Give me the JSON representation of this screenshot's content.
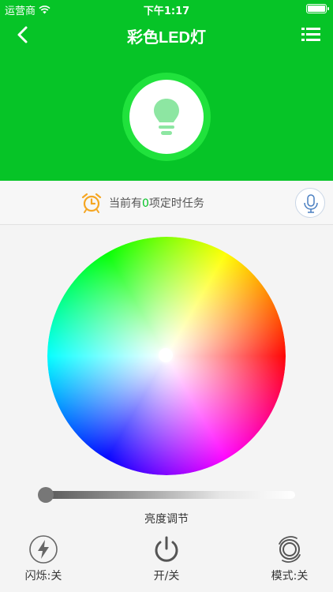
{
  "status_bar": {
    "carrier": "运营商",
    "time": "下午1:17"
  },
  "nav": {
    "title": "彩色LED灯",
    "back_icon": "chevron-left-icon",
    "menu_icon": "list-icon"
  },
  "colors": {
    "brand_green": "#06c427",
    "ring_green": "#20e23c",
    "bulb_green": "#8de6a2",
    "alarm_orange": "#f5a623"
  },
  "timer": {
    "prefix": "当前有",
    "count": "0",
    "suffix": "项定时任务",
    "icon": "alarm-clock-icon"
  },
  "voice": {
    "icon": "microphone-icon"
  },
  "brightness": {
    "label": "亮度调节",
    "value": 0
  },
  "controls": {
    "flash_label": "闪烁:关",
    "power_label": "开/关",
    "mode_label": "模式:关"
  }
}
